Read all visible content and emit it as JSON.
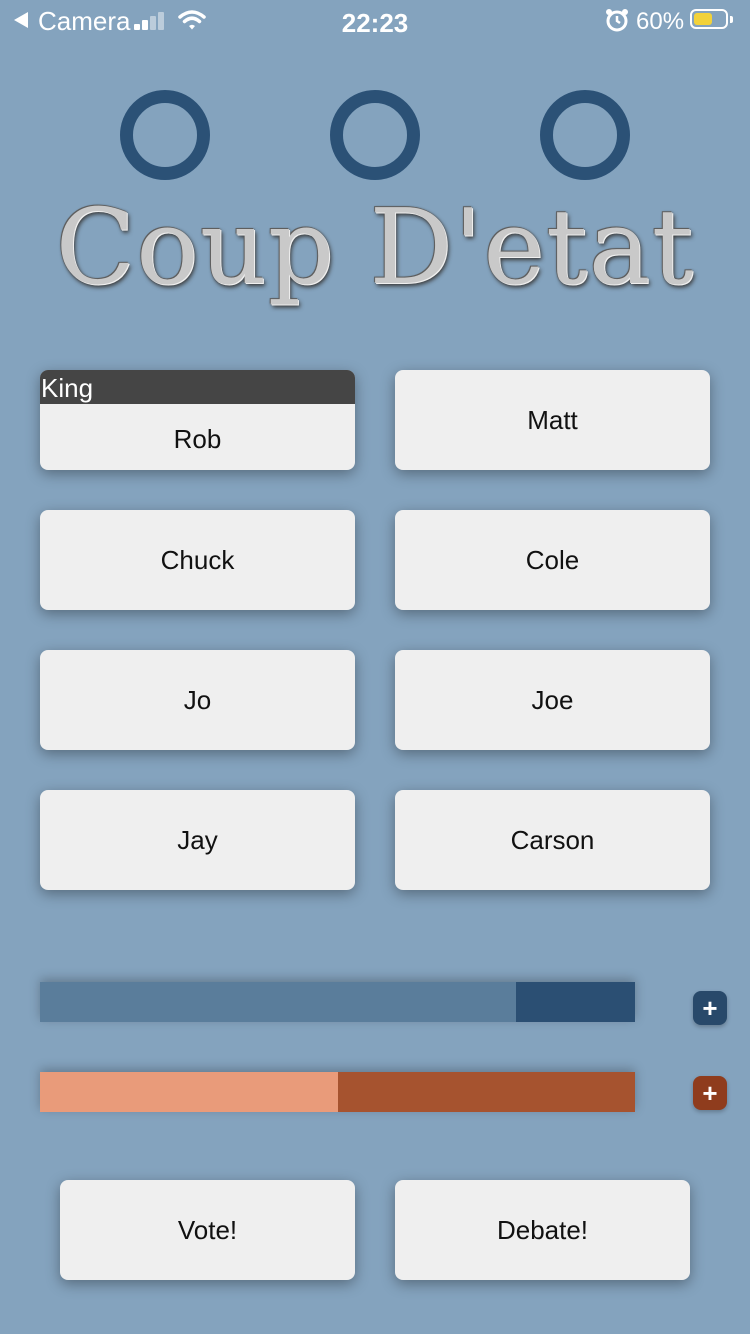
{
  "status_bar": {
    "back_label": "Camera",
    "time": "22:23",
    "battery_percent": "60%",
    "battery_level": 0.6,
    "signal_bars_filled": 2,
    "signal_bars_total": 4
  },
  "indicators": [
    {
      "name": "round-indicator-1"
    },
    {
      "name": "round-indicator-2"
    },
    {
      "name": "round-indicator-3"
    }
  ],
  "title": "Coup D'etat",
  "players": {
    "p1": {
      "name": "Rob",
      "role": "King"
    },
    "p2": {
      "name": "Matt"
    },
    "p3": {
      "name": "Chuck"
    },
    "p4": {
      "name": "Cole"
    },
    "p5": {
      "name": "Jo"
    },
    "p6": {
      "name": "Joe"
    },
    "p7": {
      "name": "Jay"
    },
    "p8": {
      "name": "Carson"
    }
  },
  "meters": {
    "blue": {
      "fraction": 0.8,
      "light_color": "#5a7d9b",
      "dark_color": "#2b4f73",
      "plus_label": "+",
      "plus_color": "#28496a"
    },
    "orange": {
      "fraction": 0.5,
      "light_color": "#e99b7a",
      "dark_color": "#a6532f",
      "plus_label": "+",
      "plus_color": "#8f3c1d"
    }
  },
  "actions": {
    "vote_label": "Vote!",
    "debate_label": "Debate!"
  },
  "colors": {
    "background": "#84a3be",
    "ring": "#2b5176",
    "card": "#efefef",
    "role_bar": "#454545"
  }
}
